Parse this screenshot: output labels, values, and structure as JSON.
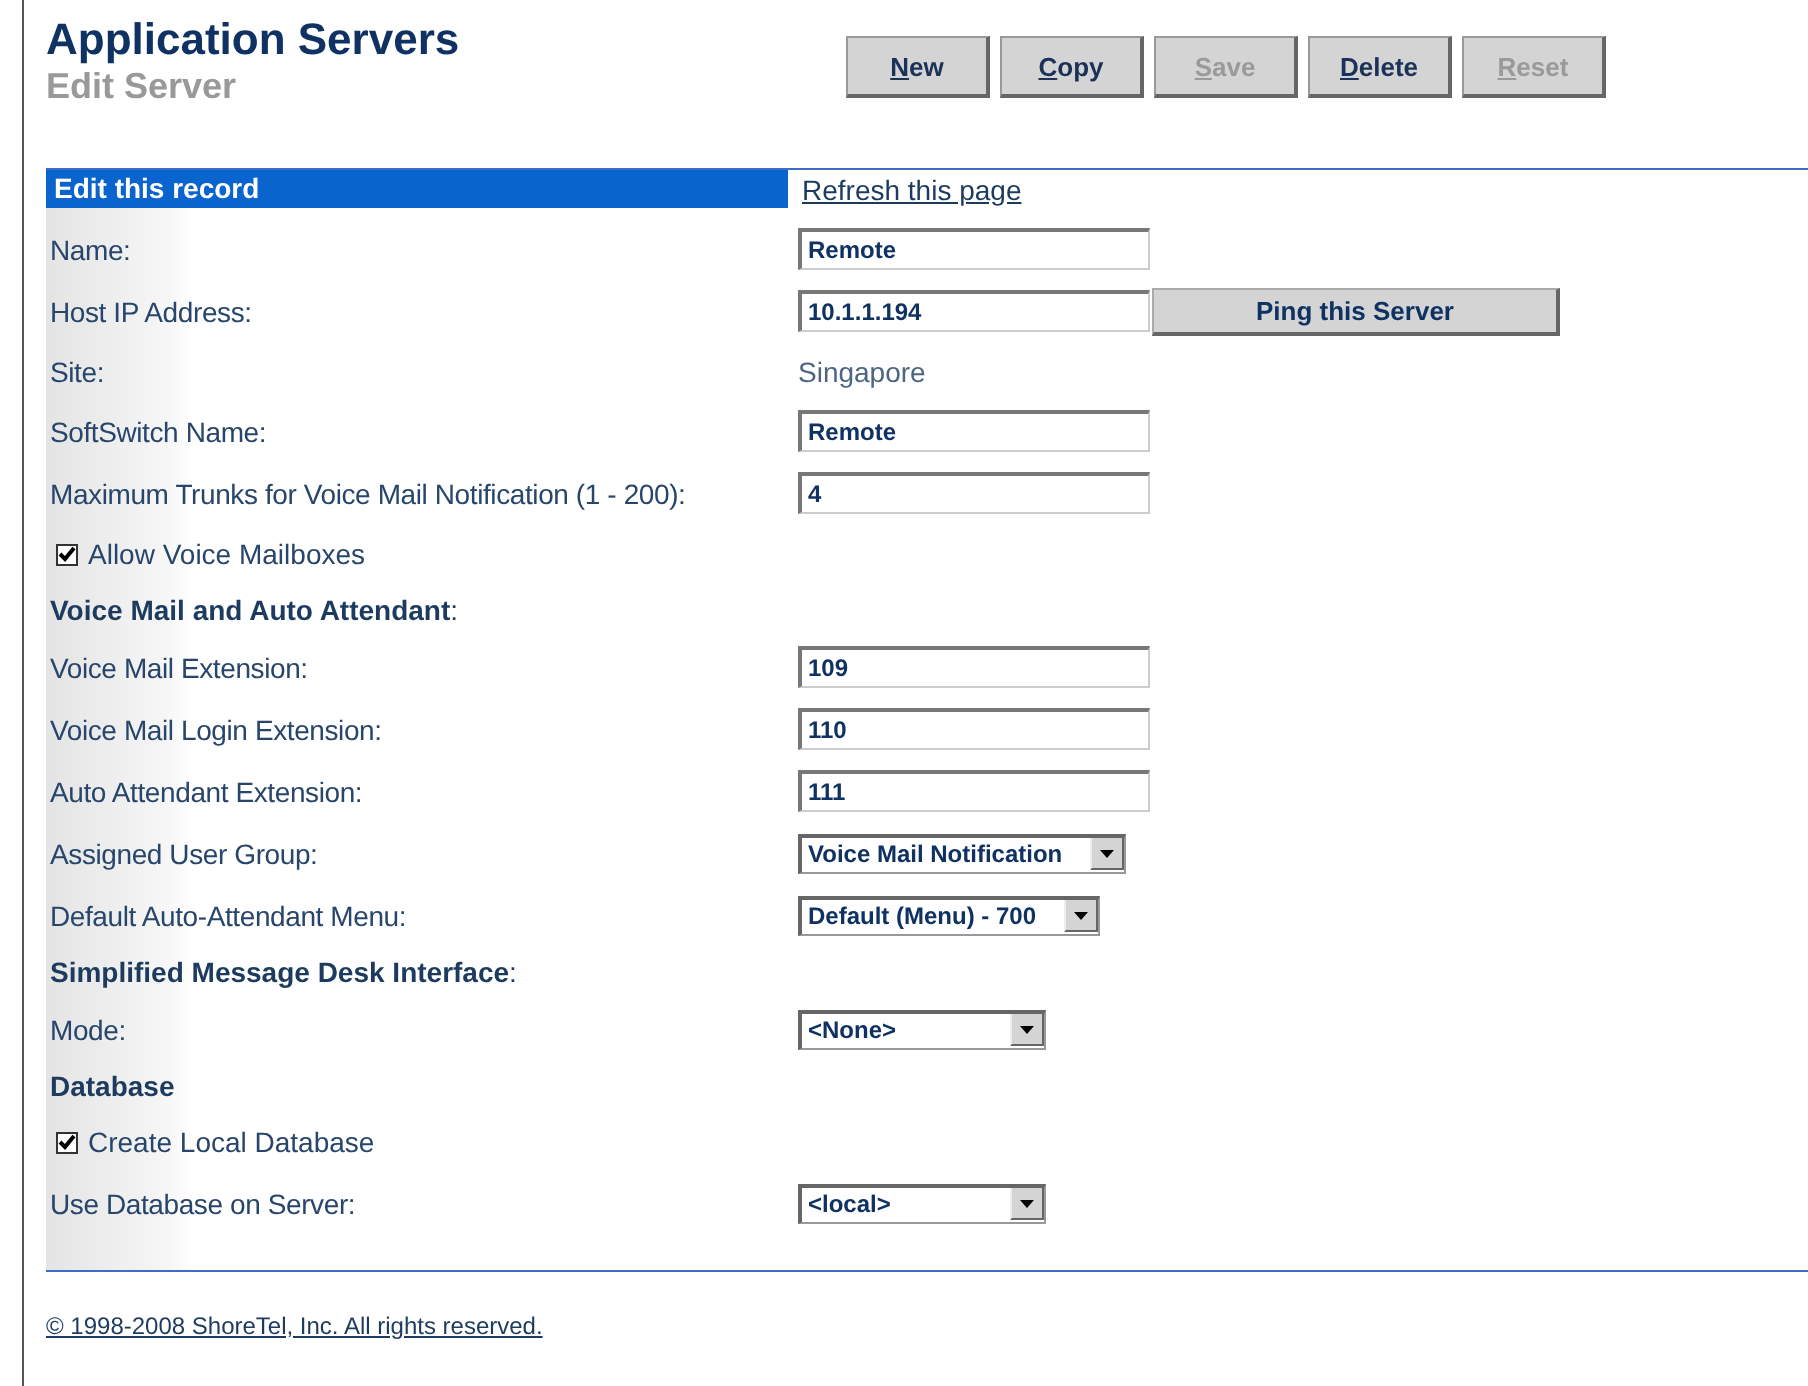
{
  "header": {
    "title": "Application Servers",
    "subtitle": "Edit Server"
  },
  "toolbar": [
    {
      "label": "New",
      "disabled": false
    },
    {
      "label": "Copy",
      "disabled": false
    },
    {
      "label": "Save",
      "disabled": true
    },
    {
      "label": "Delete",
      "disabled": false
    },
    {
      "label": "Reset",
      "disabled": true
    }
  ],
  "section": {
    "title": "Edit this record",
    "link": "Refresh this page"
  },
  "rows": [
    {
      "kind": "input",
      "label": "Name:",
      "value": "Remote"
    },
    {
      "kind": "input",
      "label": "Host IP Address:",
      "value": "10.1.1.194",
      "button": "Ping this Server"
    },
    {
      "kind": "static",
      "label": "Site:",
      "value": "Singapore"
    },
    {
      "kind": "input",
      "label": "SoftSwitch Name:",
      "value": "Remote"
    },
    {
      "kind": "input",
      "label": "Maximum Trunks for Voice Mail Notification (1 - 200):",
      "value": "4"
    },
    {
      "kind": "checkbox",
      "label": "Allow Voice Mailboxes",
      "checked": true
    },
    {
      "kind": "heading",
      "label": "**Voice Mail and Auto Attendant**:"
    },
    {
      "kind": "input",
      "label": "Voice Mail Extension:",
      "value": "109"
    },
    {
      "kind": "input",
      "label": "Voice Mail Login Extension:",
      "value": "110"
    },
    {
      "kind": "input",
      "label": "Auto Attendant Extension:",
      "value": "111"
    },
    {
      "kind": "select",
      "label": "Assigned User Group:",
      "value": "Voice Mail Notification"
    },
    {
      "kind": "select",
      "label": "Default Auto-Attendant Menu:",
      "value": "Default (Menu) - 700"
    },
    {
      "kind": "heading",
      "label": "**Simplified Message Desk Interface**:"
    },
    {
      "kind": "select",
      "label": "Mode:",
      "value": "<None>"
    },
    {
      "kind": "heading",
      "label": "**Database**"
    },
    {
      "kind": "checkbox",
      "label": "Create Local Database",
      "checked": true
    },
    {
      "kind": "select",
      "label": "Use Database on Server:",
      "value": "<local>"
    }
  ],
  "footer": "© 1998-2008 ShoreTel, Inc. All rights reserved."
}
